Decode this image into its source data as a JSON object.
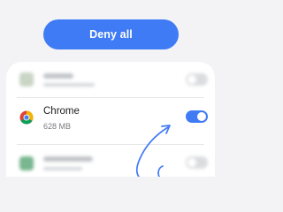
{
  "header": {
    "deny_all_label": "Deny all"
  },
  "apps": [
    {
      "name": "",
      "size": "",
      "blurred": true,
      "toggle_on": false,
      "icon": "app-icon"
    },
    {
      "name": "Chrome",
      "size": "628 MB",
      "blurred": false,
      "toggle_on": true,
      "icon": "chrome-icon"
    },
    {
      "name": "",
      "size": "",
      "blurred": true,
      "toggle_on": false,
      "icon": "app-icon"
    }
  ],
  "colors": {
    "accent": "#3f7bf5",
    "background": "#f3f3f5",
    "card": "#ffffff",
    "toggle_off": "#d0d1d6"
  }
}
